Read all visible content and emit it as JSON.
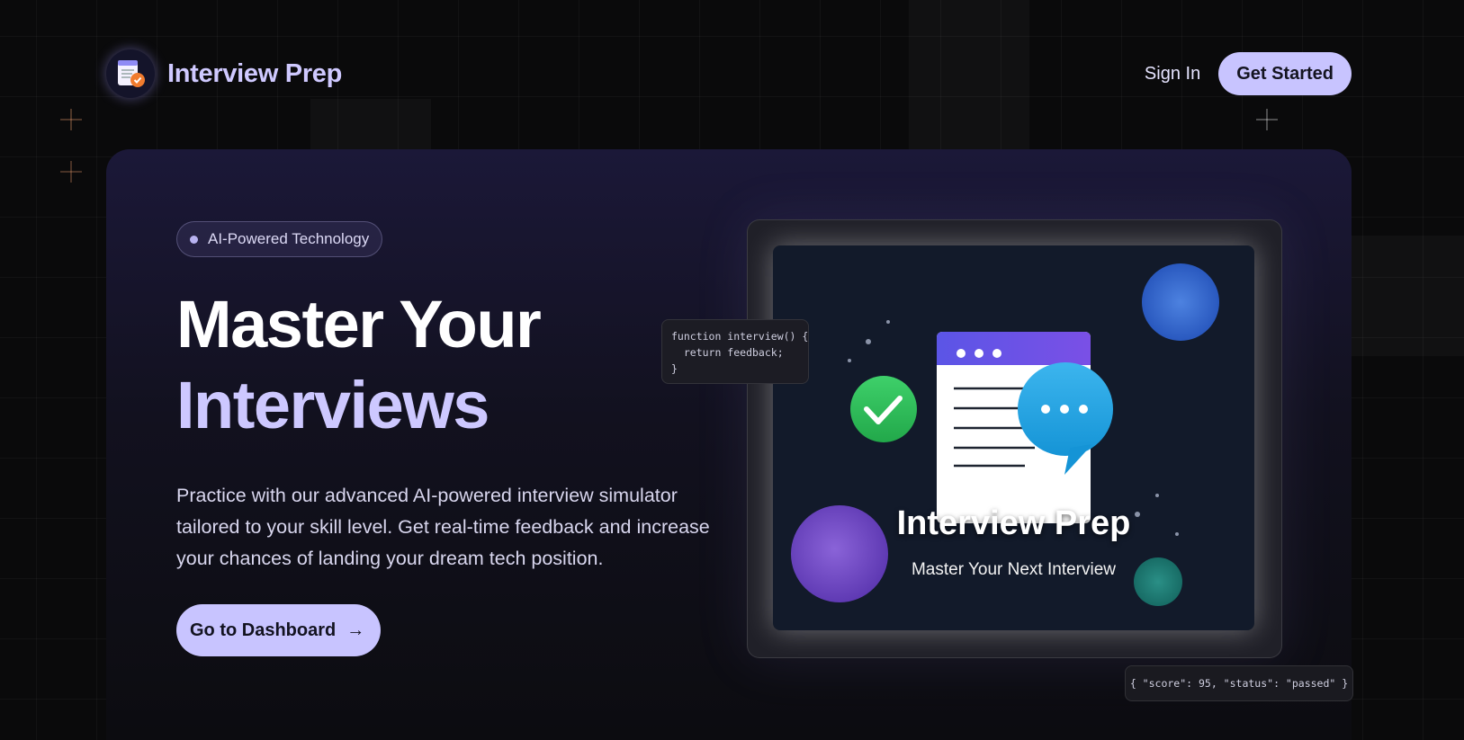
{
  "header": {
    "brand": "Interview Prep",
    "sign_in": "Sign In",
    "get_started": "Get Started"
  },
  "hero": {
    "badge": "AI-Powered Technology",
    "title_line1": "Master Your",
    "title_line2": "Interviews",
    "description": "Practice with our advanced AI-powered interview simulator tailored to your skill level. Get real-time feedback and increase your chances of landing your dream tech position.",
    "cta": "Go to Dashboard",
    "cta_arrow": "→"
  },
  "showcase": {
    "code_snippet": "function interview() {\n  return feedback;\n}",
    "json_snippet": "{ \"score\": 95, \"status\": \"passed\" }",
    "screen_title": "Interview Prep",
    "screen_subtitle": "Master Your Next Interview"
  },
  "colors": {
    "accent": "#c8c4ff",
    "brand_text": "#cfc9ff",
    "background": "#0a0a0b",
    "card": "#1b1838",
    "check_green": "#2fbf5c",
    "chat_blue": "#1ea6e6",
    "window_header": "#5b55e6"
  },
  "icons": [
    "logo-document-check-icon",
    "check-icon",
    "chat-bubble-icon",
    "arrow-right-icon"
  ]
}
